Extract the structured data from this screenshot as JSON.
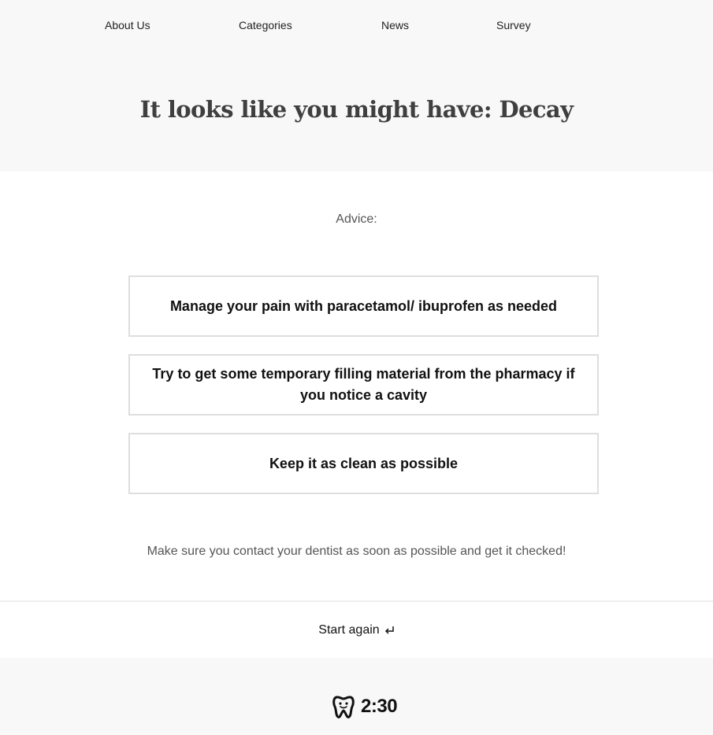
{
  "nav": {
    "items": [
      {
        "label": "About Us"
      },
      {
        "label": "Categories"
      },
      {
        "label": "News"
      },
      {
        "label": "Survey"
      }
    ]
  },
  "result": {
    "title": "It looks like you might have: Decay"
  },
  "advice": {
    "label": "Advice:",
    "items": [
      {
        "text": "Manage your pain with paracetamol/ ibuprofen as needed"
      },
      {
        "text": "Try to get some temporary filling material from the pharmacy if you notice a cavity"
      },
      {
        "text": "Keep it as clean as possible"
      }
    ],
    "note": "Make sure you contact your dentist as soon as possible and get it checked!"
  },
  "actions": {
    "restart_label": "Start again",
    "restart_icon": "return-arrow-icon"
  },
  "footer": {
    "logo_text": "2:30",
    "logo_icon": "tooth-icon"
  },
  "colors": {
    "band_background": "#f8f8f8",
    "box_border": "#dedede",
    "title_text": "#3f3f3f"
  }
}
